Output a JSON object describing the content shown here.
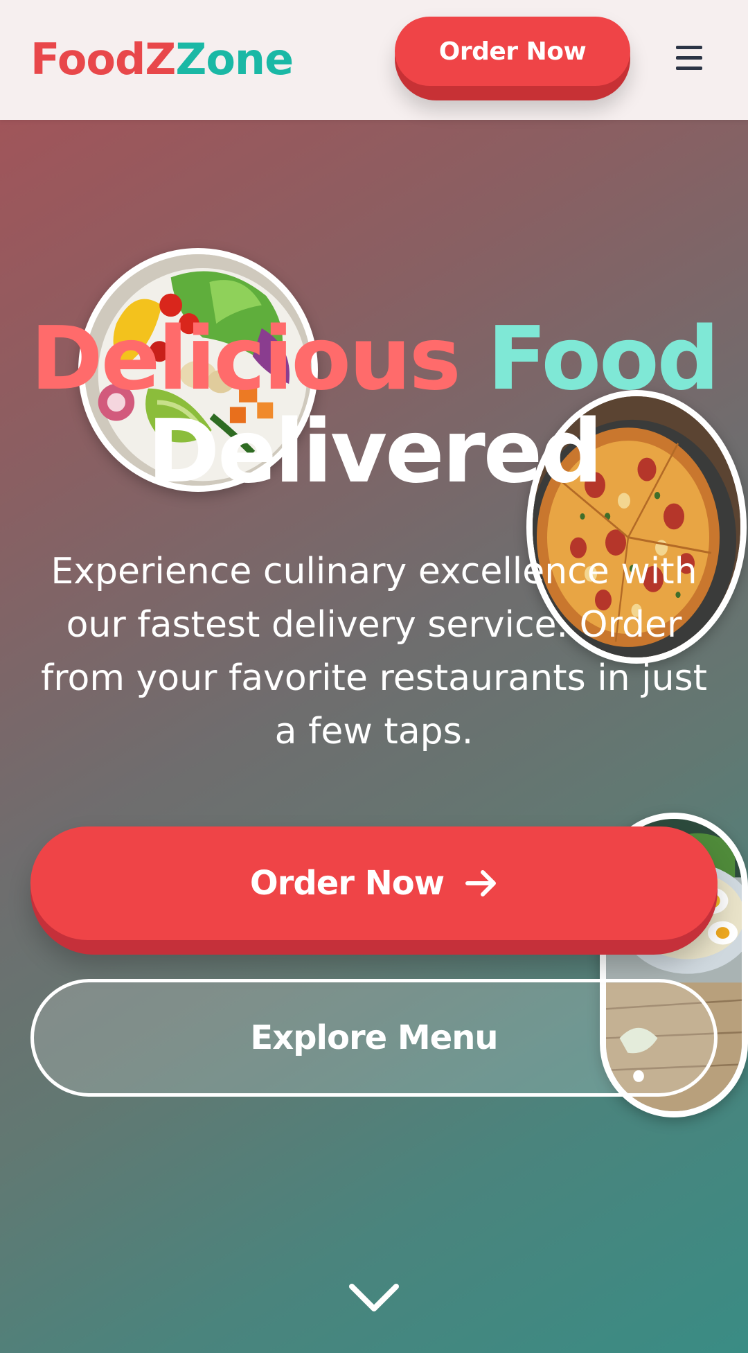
{
  "header": {
    "logo_part1": "FoodZ",
    "logo_part2": "Zone",
    "order_button_label": "Order Now",
    "menu_icon": "hamburger-menu-icon"
  },
  "hero": {
    "headline_word1": "Delicious",
    "headline_word2": "Food",
    "headline_line2": "Delivered",
    "subtitle": "Experience culinary excellence with our fastest delivery service. Order from your favorite restaurants in just a few taps.",
    "primary_cta_label": "Order Now",
    "primary_cta_icon": "arrow-right-icon",
    "secondary_cta_label": "Explore Menu",
    "scroll_icon": "chevron-down-icon",
    "images": [
      "salad-bowl-image",
      "pizza-image",
      "egg-bowl-image"
    ]
  },
  "colors": {
    "brand_red": "#ef4447",
    "brand_teal": "#1ab8a5",
    "headline_red": "#ff6b6b",
    "headline_teal": "#7fe8d6",
    "header_bg": "#f6efef"
  }
}
